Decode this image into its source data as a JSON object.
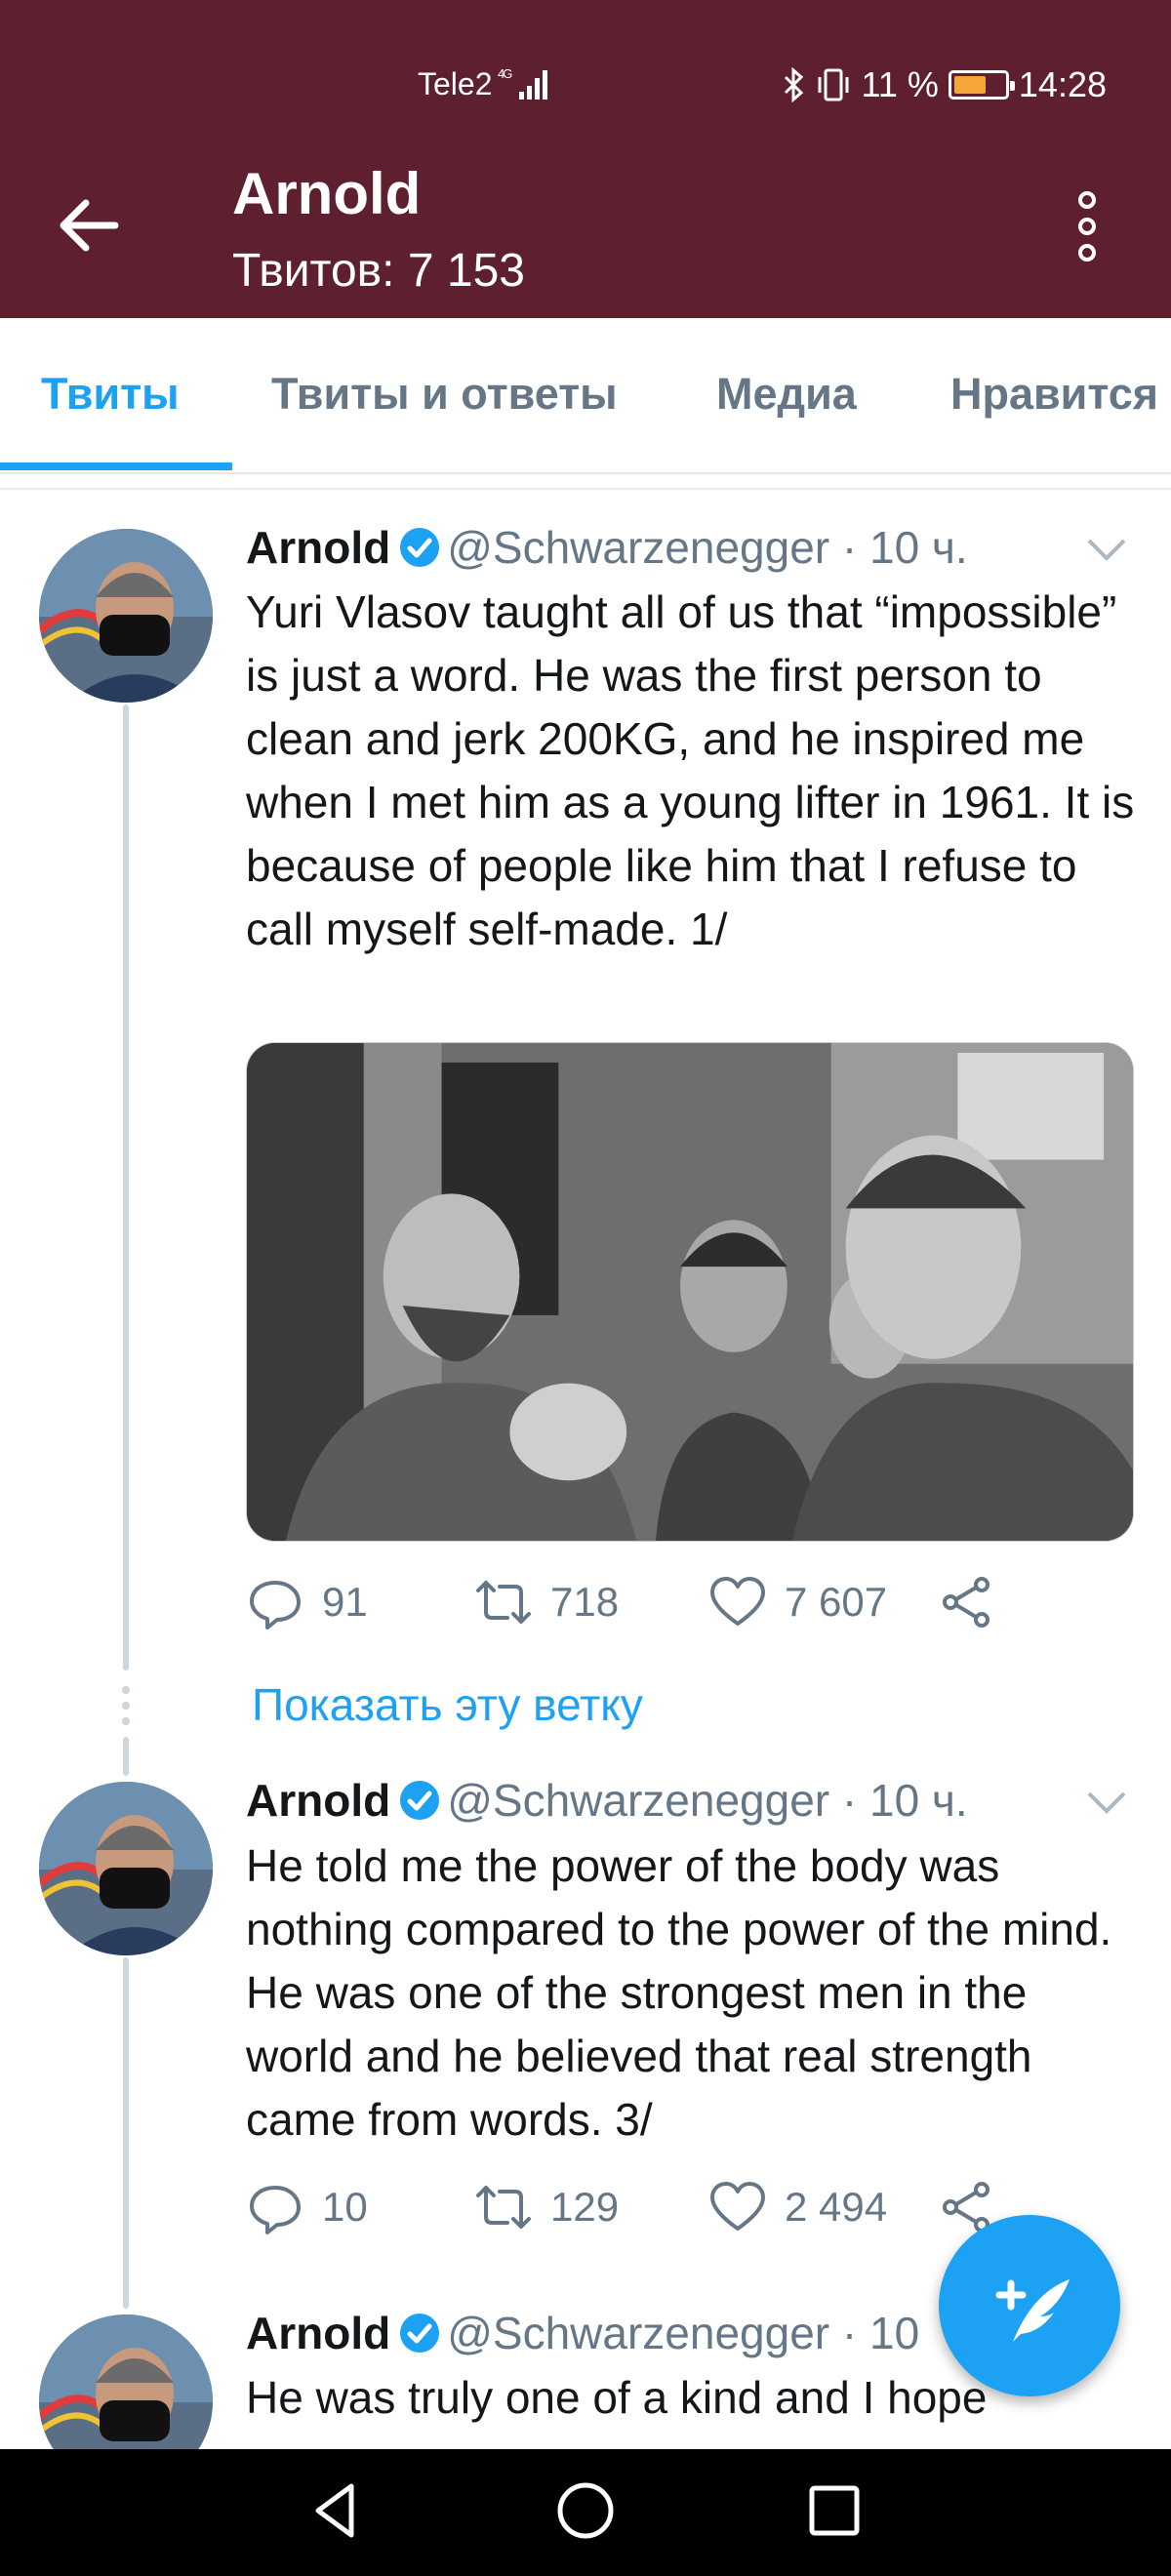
{
  "status_bar": {
    "carrier": "Tele2",
    "network": "4G",
    "battery_percent": "11 %",
    "time": "14:28"
  },
  "header": {
    "title": "Arnold",
    "subtitle": "Твитов: 7 153",
    "background_color": "#5e1f2e"
  },
  "tabs": [
    {
      "label": "Твиты",
      "active": true
    },
    {
      "label": "Твиты и ответы",
      "active": false
    },
    {
      "label": "Медиа",
      "active": false
    },
    {
      "label": "Нравится",
      "active": false
    }
  ],
  "tweets": [
    {
      "name": "Arnold",
      "handle": "@Schwarzenegger",
      "time": "· 10 ч.",
      "text": "Yuri Vlasov taught all of us that “impossible” is just a word. He was the first person to clean and jerk 200KG, and he inspired me when I met him as a young lifter in 1961. It is because of people like him that I refuse to call myself self-made. 1/",
      "replies": "91",
      "retweets": "718",
      "likes": "7 607"
    },
    {
      "name": "Arnold",
      "handle": "@Schwarzenegger",
      "time": "· 10 ч.",
      "text": "He told me the power of the body was nothing compared to the power of the mind. He was one of the strongest men in the world and he believed that real strength came from words. 3/",
      "replies": "10",
      "retweets": "129",
      "likes": "2 494"
    },
    {
      "name": "Arnold",
      "handle": "@Schwarzenegger",
      "time": "· 10",
      "text": "He was truly one of a kind and I hope"
    }
  ],
  "show_thread": "Показать эту ветку",
  "colors": {
    "accent": "#1da1f2",
    "muted": "#657786"
  },
  "icons": [
    "back-arrow-icon",
    "more-vertical-icon",
    "verified-icon",
    "chevron-down-icon",
    "reply-icon",
    "retweet-icon",
    "like-icon",
    "share-icon",
    "compose-icon",
    "nav-back-icon",
    "nav-home-icon",
    "nav-recents-icon"
  ]
}
